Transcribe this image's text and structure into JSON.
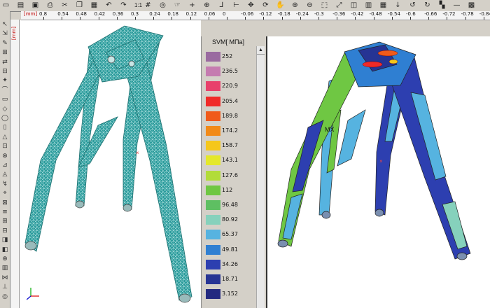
{
  "toolbar": {
    "zoom_label": "1:1",
    "icons": [
      "new-file-icon",
      "open-file-icon",
      "save-icon",
      "print-icon",
      "cut-icon",
      "copy-icon",
      "paste-icon",
      "undo-icon",
      "redo-icon",
      "zoom-ratio",
      "grid-icon",
      "mesh-icon",
      "select-icon",
      "crosshair-icon",
      "target-icon",
      "axis-icon",
      "measure-icon",
      "move-icon",
      "rotate-icon",
      "pan-icon",
      "zoom-in-icon",
      "zoom-out-icon",
      "zoom-window-icon",
      "fit-icon",
      "view-icon",
      "result-icon",
      "table-icon",
      "arrow-down-icon",
      "rotate-left-icon",
      "rotate-right-icon",
      "chart-icon",
      "minus-icon",
      "fill-icon"
    ]
  },
  "ruler": {
    "unit": "[mm]",
    "ticks": [
      "0.8",
      "0.54",
      "0.48",
      "0.42",
      "0.36",
      "0.3",
      "0.24",
      "0.18",
      "0.12",
      "0.06",
      "0",
      "-0.06",
      "-0.12",
      "-0.18",
      "-0.24",
      "-0.3",
      "-0.36",
      "-0.42",
      "-0.48",
      "-0.54",
      "-0.6",
      "-0.66",
      "-0.72",
      "-0.78",
      "-0.84"
    ]
  },
  "vruler": {
    "unit": "[mm]"
  },
  "legend": {
    "title": "SVM[ МПа]",
    "entries": [
      {
        "value": "252",
        "color": "#9a6aa0"
      },
      {
        "value": "236.5",
        "color": "#c57bb0"
      },
      {
        "value": "220.9",
        "color": "#e8416b"
      },
      {
        "value": "205.4",
        "color": "#f02a28"
      },
      {
        "value": "189.8",
        "color": "#f05a1a"
      },
      {
        "value": "174.2",
        "color": "#f28a18"
      },
      {
        "value": "158.7",
        "color": "#f5c71b"
      },
      {
        "value": "143.1",
        "color": "#e4e82a"
      },
      {
        "value": "127.6",
        "color": "#b2dc3a"
      },
      {
        "value": "112",
        "color": "#6fc743"
      },
      {
        "value": "96.48",
        "color": "#5ebf62"
      },
      {
        "value": "80.92",
        "color": "#86d1bc"
      },
      {
        "value": "65.37",
        "color": "#56b3e0"
      },
      {
        "value": "49.81",
        "color": "#2f7fd2"
      },
      {
        "value": "34.26",
        "color": "#2d3fb0"
      },
      {
        "value": "18.71",
        "color": "#263494"
      },
      {
        "value": "3.152",
        "color": "#242a80"
      }
    ]
  },
  "right_view": {
    "label": "MX"
  },
  "colors": {
    "mesh": "#2a9b9b",
    "mesh_line": "#c9efef",
    "background": "#ffffff",
    "chrome": "#d4d0c8"
  }
}
